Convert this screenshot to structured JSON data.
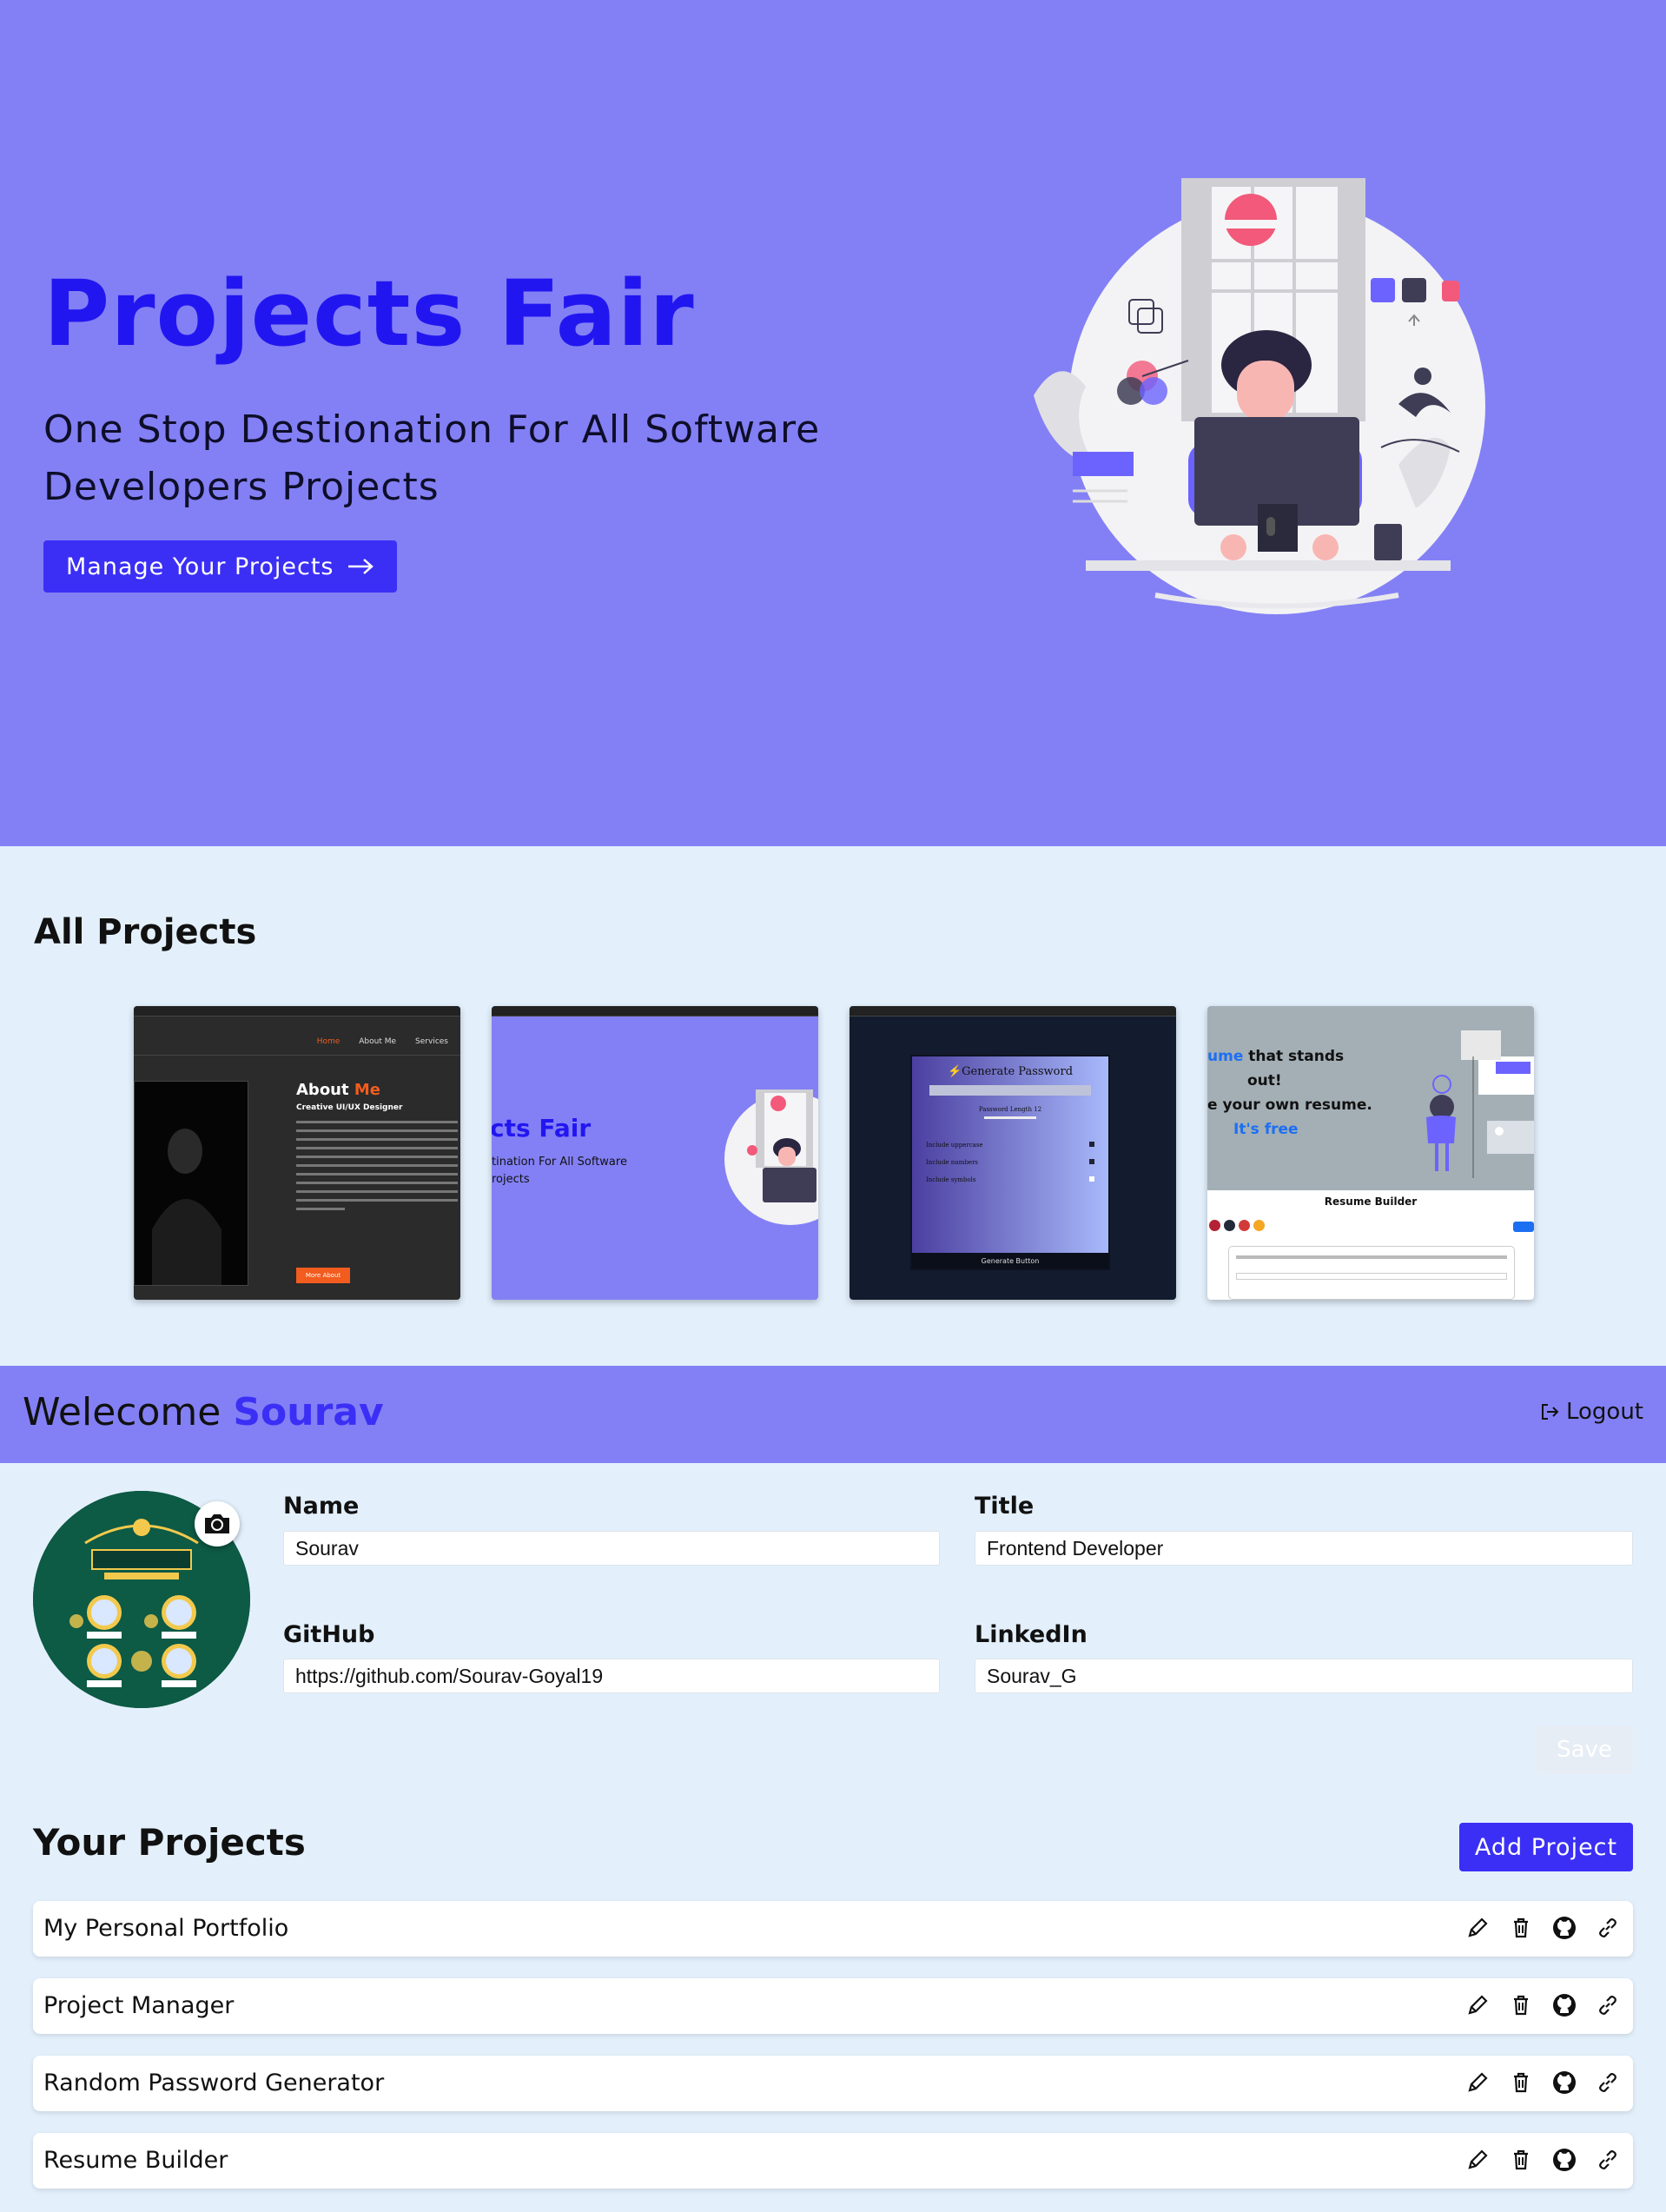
{
  "hero": {
    "title": "Projects Fair",
    "subtitle": "One Stop Destionation For All Software Developers Projects",
    "cta_label": "Manage Your Projects"
  },
  "all_projects": {
    "heading": "All Projects",
    "thumbnails": [
      {
        "nav": [
          "Home",
          "About Me",
          "Services"
        ],
        "heading": "About",
        "heading_accent": "Me",
        "subheading": "Creative UI/UX Designer",
        "button": "More About"
      },
      {
        "title_fragment": "cts Fair",
        "subtitle_fragment": "tination For All Software",
        "subtitle_fragment2": "rojects"
      },
      {
        "heading": "⚡Generate Password",
        "length_label": "Password Length 12",
        "options": [
          "Include uppercase",
          "Include numbers",
          "Include symbols"
        ],
        "button": "Generate Button"
      },
      {
        "hero_accent": "ume",
        "hero_line1": " that stands",
        "hero_line2": "out!",
        "hero_line3": "e your own resume.",
        "hero_line4": "It's free",
        "section_title": "Resume Builder"
      }
    ]
  },
  "welcome": {
    "greeting": "Welecome",
    "name": "Sourav",
    "logout_label": "Logout"
  },
  "profile": {
    "name_label": "Name",
    "name_value": "Sourav",
    "title_label": "Title",
    "title_value": "Frontend Developer",
    "github_label": "GitHub",
    "github_value": "https://github.com/Sourav-Goyal19",
    "linkedin_label": "LinkedIn",
    "linkedin_value": "Sourav_G",
    "save_label": "Save"
  },
  "your_projects": {
    "heading": "Your Projects",
    "add_label": "Add Project",
    "items": [
      {
        "name": "My Personal Portfolio"
      },
      {
        "name": "Project Manager"
      },
      {
        "name": "Random Password Generator"
      },
      {
        "name": "Resume Builder"
      }
    ]
  },
  "colors": {
    "hero_bg": "#8380f5",
    "accent": "#3b2ff5",
    "title_blue": "#2216f0",
    "page_bg": "#e3f0fc"
  }
}
